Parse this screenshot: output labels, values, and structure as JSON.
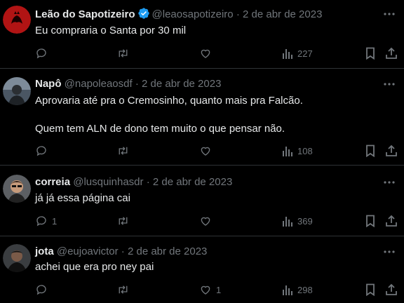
{
  "tweets": [
    {
      "name": "Leão do Sapotizeiro",
      "verified": true,
      "handle": "@leaosapotizeiro",
      "date": "2 de abr de 2023",
      "text": "Eu compraria o Santa por 30 mil",
      "reply_count": "",
      "like_count": "",
      "views": "227"
    },
    {
      "name": "Napô",
      "verified": false,
      "handle": "@napoleaosdf",
      "date": "2 de abr de 2023",
      "text": "Aprovaria até pra o Cremosinho, quanto mais pra Falcão.\n\nQuem tem ALN de dono tem muito o que pensar não.",
      "reply_count": "",
      "like_count": "",
      "views": "108"
    },
    {
      "name": "correia",
      "verified": false,
      "handle": "@lusquinhasdr",
      "date": "2 de abr de 2023",
      "text": "já já essa página cai",
      "reply_count": "1",
      "like_count": "",
      "views": "369"
    },
    {
      "name": "jota",
      "verified": false,
      "handle": "@eujoavictor",
      "date": "2 de abr de 2023",
      "text": "achei que era pro ney pai",
      "reply_count": "",
      "like_count": "1",
      "views": "298"
    }
  ],
  "separator": "·",
  "colors": {
    "background": "#000000",
    "text": "#e7e9ea",
    "muted": "#71767b",
    "verified": "#1d9bf0",
    "divider": "#2f3336"
  },
  "icons": [
    "avatar",
    "verified-badge-icon",
    "more-icon",
    "reply-icon",
    "retweet-icon",
    "like-icon",
    "views-icon",
    "bookmark-icon",
    "share-icon"
  ]
}
